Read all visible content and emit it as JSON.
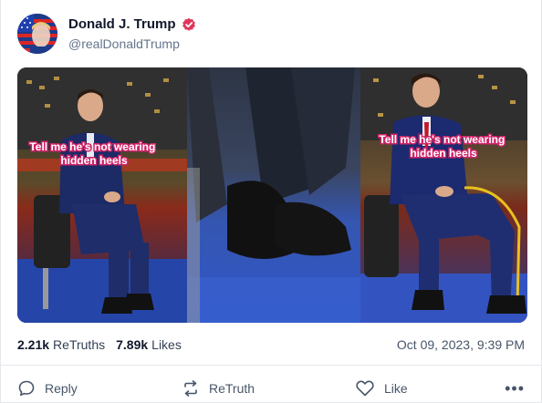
{
  "post": {
    "author": {
      "display_name": "Donald J. Trump",
      "handle": "@realDonaldTrump",
      "verified": true,
      "verified_color": "#e0365b",
      "avatar_icon": "american-flag-portrait"
    },
    "media": {
      "panels": [
        {
          "caption": "Tell me he's not wearing hidden heels"
        },
        {
          "caption": ""
        },
        {
          "caption": "Tell me he's not wearing hidden heels"
        }
      ]
    },
    "stats": {
      "retruths_count": "2.21k",
      "retruths_label": "ReTruths",
      "likes_count": "7.89k",
      "likes_label": "Likes",
      "timestamp": "Oct 09, 2023, 9:39 PM"
    },
    "actions": {
      "reply_label": "Reply",
      "retruth_label": "ReTruth",
      "like_label": "Like",
      "more_label": "•••"
    }
  }
}
